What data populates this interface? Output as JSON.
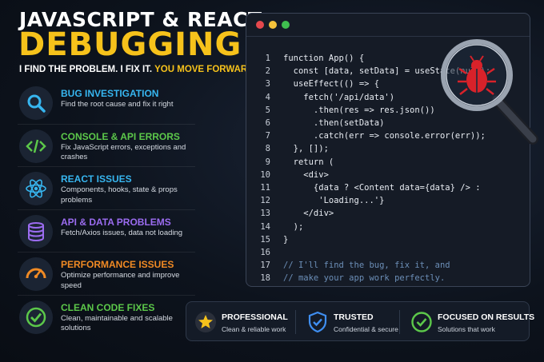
{
  "header": {
    "title_line1": "JAVASCRIPT & REACT",
    "title_line2": "DEBUGGING",
    "tagline_part1": "I FIND THE PROBLEM. I FIX IT.",
    "tagline_part2": "YOU MOVE FORWARD."
  },
  "services": [
    {
      "title": "BUG INVESTIGATION",
      "desc": "Find the root cause and fix it right",
      "color": "#37b6f0",
      "icon": "magnifier-icon"
    },
    {
      "title": "CONSOLE & API ERRORS",
      "desc": "Fix JavaScript errors, exceptions and crashes",
      "color": "#5cc84a",
      "icon": "code-brackets-icon"
    },
    {
      "title": "REACT ISSUES",
      "desc": "Components, hooks, state & props problems",
      "color": "#37b6f0",
      "icon": "react-atom-icon"
    },
    {
      "title": "API & DATA PROBLEMS",
      "desc": "Fetch/Axios issues, data not loading",
      "color": "#9b6cf0",
      "icon": "database-icon"
    },
    {
      "title": "PERFORMANCE ISSUES",
      "desc": "Optimize performance and improve speed",
      "color": "#f08a24",
      "icon": "speedometer-icon"
    },
    {
      "title": "CLEAN CODE FIXES",
      "desc": "Clean, maintainable and scalable solutions",
      "color": "#5cc84a",
      "icon": "check-circle-icon"
    }
  ],
  "code": {
    "window_dots": [
      "#e5484d",
      "#f5c23b",
      "#3fbf4f"
    ],
    "lines": [
      {
        "n": "1",
        "text": "function App() {"
      },
      {
        "n": "2",
        "text": "  const [data, setData] = useState(null);"
      },
      {
        "n": "3",
        "text": "  useEffect(() => {"
      },
      {
        "n": "4",
        "text": "    fetch('/api/data')"
      },
      {
        "n": "5",
        "text": "      .then(res => res.json())"
      },
      {
        "n": "6",
        "text": "      .then(setData)"
      },
      {
        "n": "7",
        "text": "      .catch(err => console.error(err));"
      },
      {
        "n": "8",
        "text": "  }, []);"
      },
      {
        "n": "9",
        "text": "  return ("
      },
      {
        "n": "10",
        "text": "    <div>"
      },
      {
        "n": "11",
        "text": "      {data ? <Content data={data} /> :"
      },
      {
        "n": "12",
        "text": "       'Loading...'}"
      },
      {
        "n": "13",
        "text": "    </div>"
      },
      {
        "n": "14",
        "text": "  );"
      },
      {
        "n": "15",
        "text": "}"
      },
      {
        "n": "16",
        "text": ""
      },
      {
        "n": "17",
        "text": "// I'll find the bug, fix it, and"
      },
      {
        "n": "18",
        "text": "// make your app work perfectly."
      }
    ]
  },
  "badges": [
    {
      "title": "PROFESSIONAL",
      "sub": "Clean & reliable work",
      "icon": "star-icon"
    },
    {
      "title": "TRUSTED",
      "sub": "Confidential & secure",
      "icon": "shield-check-icon"
    },
    {
      "title": "FOCUSED ON RESULTS",
      "sub": "Solutions that work",
      "icon": "check-circle-icon"
    }
  ],
  "colors": {
    "accent_yellow": "#f6c21b",
    "bug_red": "#d8222a"
  }
}
